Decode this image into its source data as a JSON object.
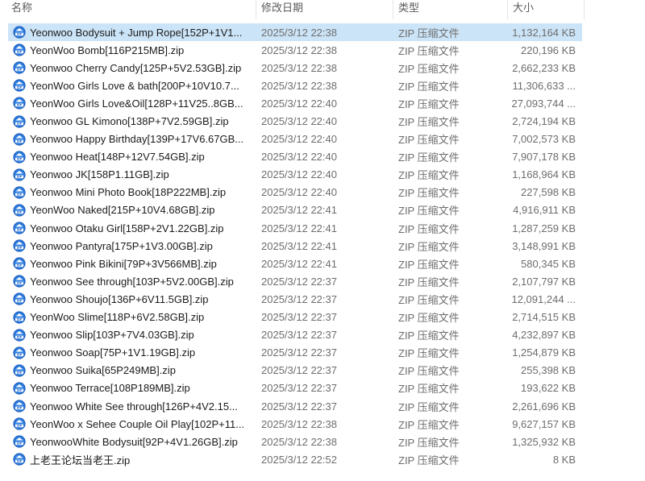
{
  "columns": {
    "name": "名称",
    "date": "修改日期",
    "type": "类型",
    "size": "大小"
  },
  "icon": "zip-file-icon",
  "files": [
    {
      "name": "Yeonwoo Bodysuit + Jump Rope[152P+1V1...",
      "date": "2025/3/12 22:38",
      "type": "ZIP 压缩文件",
      "size": "1,132,164 KB",
      "selected": true
    },
    {
      "name": "YeonWoo Bomb[116P215MB].zip",
      "date": "2025/3/12 22:38",
      "type": "ZIP 压缩文件",
      "size": "220,196 KB"
    },
    {
      "name": "Yeonwoo Cherry Candy[125P+5V2.53GB].zip",
      "date": "2025/3/12 22:38",
      "type": "ZIP 压缩文件",
      "size": "2,662,233 KB"
    },
    {
      "name": "YeonWoo Girls Love & bath[200P+10V10.7...",
      "date": "2025/3/12 22:38",
      "type": "ZIP 压缩文件",
      "size": "11,306,633 ..."
    },
    {
      "name": "YeonWoo Girls Love&Oil[128P+11V25..8GB...",
      "date": "2025/3/12 22:40",
      "type": "ZIP 压缩文件",
      "size": "27,093,744 ..."
    },
    {
      "name": "Yeonwoo GL Kimono[138P+7V2.59GB].zip",
      "date": "2025/3/12 22:40",
      "type": "ZIP 压缩文件",
      "size": "2,724,194 KB"
    },
    {
      "name": "Yeonwoo Happy Birthday[139P+17V6.67GB...",
      "date": "2025/3/12 22:40",
      "type": "ZIP 压缩文件",
      "size": "7,002,573 KB"
    },
    {
      "name": "Yeonwoo Heat[148P+12V7.54GB].zip",
      "date": "2025/3/12 22:40",
      "type": "ZIP 压缩文件",
      "size": "7,907,178 KB"
    },
    {
      "name": "Yeonwoo JK[158P1.11GB].zip",
      "date": "2025/3/12 22:40",
      "type": "ZIP 压缩文件",
      "size": "1,168,964 KB"
    },
    {
      "name": "Yeonwoo Mini Photo Book[18P222MB].zip",
      "date": "2025/3/12 22:40",
      "type": "ZIP 压缩文件",
      "size": "227,598 KB"
    },
    {
      "name": "YeonWoo Naked[215P+10V4.68GB].zip",
      "date": "2025/3/12 22:41",
      "type": "ZIP 压缩文件",
      "size": "4,916,911 KB"
    },
    {
      "name": "Yeonwoo Otaku Girl[158P+2V1.22GB].zip",
      "date": "2025/3/12 22:41",
      "type": "ZIP 压缩文件",
      "size": "1,287,259 KB"
    },
    {
      "name": "Yeonwoo Pantyra[175P+1V3.00GB].zip",
      "date": "2025/3/12 22:41",
      "type": "ZIP 压缩文件",
      "size": "3,148,991 KB"
    },
    {
      "name": "Yeonwoo Pink Bikini[79P+3V566MB].zip",
      "date": "2025/3/12 22:41",
      "type": "ZIP 压缩文件",
      "size": "580,345 KB"
    },
    {
      "name": "Yeonwoo See through[103P+5V2.00GB].zip",
      "date": "2025/3/12 22:37",
      "type": "ZIP 压缩文件",
      "size": "2,107,797 KB"
    },
    {
      "name": "Yeonwoo Shoujo[136P+6V11.5GB].zip",
      "date": "2025/3/12 22:37",
      "type": "ZIP 压缩文件",
      "size": "12,091,244 ..."
    },
    {
      "name": "YeonWoo Slime[118P+6V2.58GB].zip",
      "date": "2025/3/12 22:37",
      "type": "ZIP 压缩文件",
      "size": "2,714,515 KB"
    },
    {
      "name": "Yeonwoo Slip[103P+7V4.03GB].zip",
      "date": "2025/3/12 22:37",
      "type": "ZIP 压缩文件",
      "size": "4,232,897 KB"
    },
    {
      "name": "Yeonwoo Soap[75P+1V1.19GB].zip",
      "date": "2025/3/12 22:37",
      "type": "ZIP 压缩文件",
      "size": "1,254,879 KB"
    },
    {
      "name": "Yeonwoo Suika[65P249MB].zip",
      "date": "2025/3/12 22:37",
      "type": "ZIP 压缩文件",
      "size": "255,398 KB"
    },
    {
      "name": "Yeonwoo Terrace[108P189MB].zip",
      "date": "2025/3/12 22:37",
      "type": "ZIP 压缩文件",
      "size": "193,622 KB"
    },
    {
      "name": "Yeonwoo White See through[126P+4V2.15...",
      "date": "2025/3/12 22:37",
      "type": "ZIP 压缩文件",
      "size": "2,261,696 KB"
    },
    {
      "name": "YeonWoo x Sehee Couple Oil Play[102P+11...",
      "date": "2025/3/12 22:38",
      "type": "ZIP 压缩文件",
      "size": "9,627,157 KB"
    },
    {
      "name": "YeonwooWhite Bodysuit[92P+4V1.26GB].zip",
      "date": "2025/3/12 22:38",
      "type": "ZIP 压缩文件",
      "size": "1,325,932 KB"
    },
    {
      "name": "上老王论坛当老王.zip",
      "date": "2025/3/12 22:52",
      "type": "ZIP 压缩文件",
      "size": "8 KB"
    }
  ]
}
